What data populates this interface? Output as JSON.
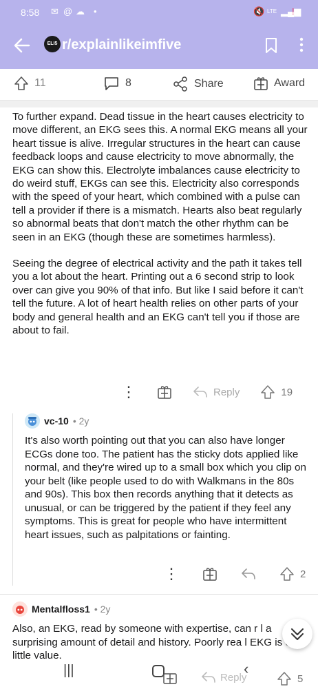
{
  "status_bar": {
    "time": "8:58",
    "signal": "LTE"
  },
  "header": {
    "subreddit": "r/explainlikeimfive",
    "logo_text": "ELI5"
  },
  "post_actions": {
    "upvotes": "11",
    "comments": "8",
    "share": "Share",
    "award": "Award"
  },
  "comment": {
    "paragraphs": [
      "To further expand.  Dead tissue in the heart causes electricity to move different, an EKG sees this.  A normal EKG means all your heart tissue is alive.  Irregular structures in the heart can cause feedback loops and cause electricity to move abnormally, the EKG can show this.  Electrolyte imbalances cause electricity to do weird stuff, EKGs can see this.  Electricity also corresponds with the speed of your heart, which combined with a pulse can tell a provider if there is a mismatch.  Hearts also beat regularly so abnormal beats that don't match the other rhythm can be seen in an EKG (though these are sometimes harmless).",
      "Seeing the degree of electrical activity and the path it takes tell you a lot about the heart.  Printing out a 6 second strip to look over can give you 90% of that info.  But like I said before it can't tell the future.  A lot of heart health relies on other parts of your body and general health and an EKG can't tell you if those are about to fail."
    ],
    "reply_label": "Reply",
    "votes": "19"
  },
  "reply1": {
    "author": "vc-10",
    "age": "• 2y",
    "text": "It's also worth pointing out that you can also have longer ECGs done too. The patient has the sticky dots applied like normal, and they're wired up to a small box which you clip on your belt (like people used to do with Walkmans in the 80s and 90s). This box then records anything that it detects as unusual, or can be triggered by the patient if they feel any symptoms. This is great for people who have intermittent heart issues, such as palpitations or fainting.",
    "votes": "2"
  },
  "reply2": {
    "author": "Mentalfloss1",
    "age": "• 2y",
    "text": "Also, an EKG, read by someone with expertise, can r      l a surprising amount of detail and history.  Poorly rea      l EKG is of little value.",
    "reply_label": "Reply",
    "votes": "5"
  },
  "colors": {
    "header_bg": "#b7b3ec",
    "text": "#1a1a1b",
    "muted": "#888888"
  }
}
